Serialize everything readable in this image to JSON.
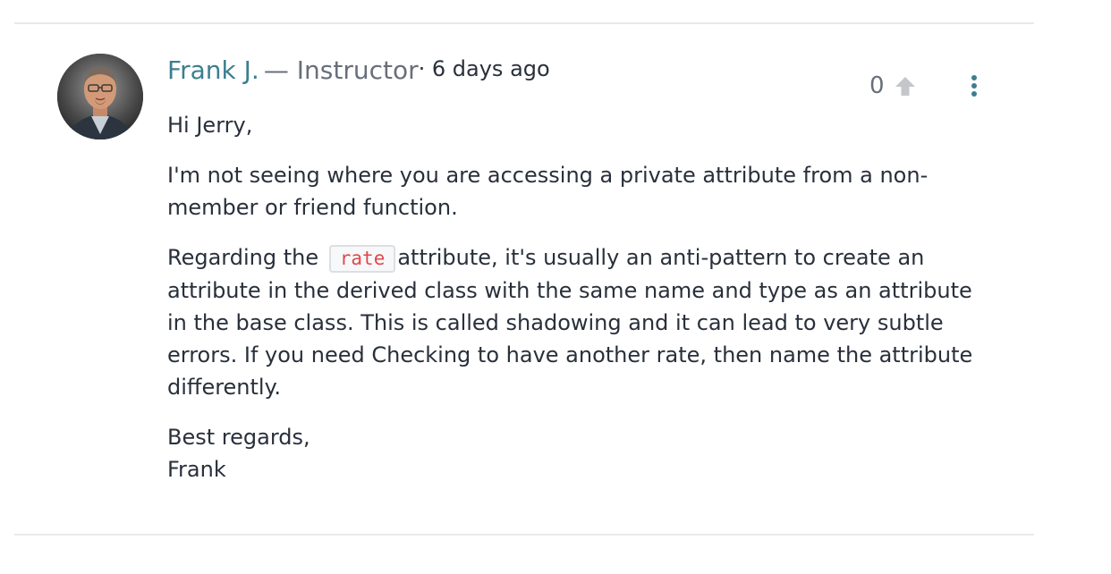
{
  "comment": {
    "author": "Frank J.",
    "role_separator": "—",
    "role": "Instructor",
    "time_prefix": "·",
    "time": "6 days ago",
    "upvotes": "0",
    "greeting": "Hi Jerry,",
    "paragraph1": "I'm not seeing where you are accessing a private attribute from a non-member or friend function.",
    "paragraph2_prefix": "Regarding the",
    "paragraph2_code": "rate",
    "paragraph2_suffix": "attribute, it's usually an anti-pattern to create an attribute in the derived class with the same name and type as an attribute in the base class. This is called shadowing and it can lead to very subtle errors. If you need Checking to have another rate, then name the attribute differently.",
    "closing": "Best regards,",
    "signature": "Frank"
  },
  "icons": {
    "upvote": "arrow-up-icon",
    "more": "more-vertical-icon"
  },
  "colors": {
    "author_link": "#3d7e8f",
    "muted_text": "#686f7a",
    "body_text": "#29303b",
    "code_text": "#e0494c",
    "upvote_icon": "#c4c6c9",
    "more_icon": "#3d7e8f",
    "divider": "#e8e9eb"
  }
}
